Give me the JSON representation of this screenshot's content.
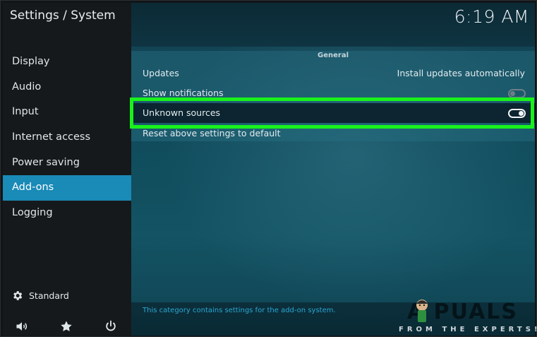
{
  "window": {
    "title": "Settings / System",
    "clock": "6:19 AM"
  },
  "sidebar": {
    "items": [
      {
        "label": "Display",
        "active": false
      },
      {
        "label": "Audio",
        "active": false
      },
      {
        "label": "Input",
        "active": false
      },
      {
        "label": "Internet access",
        "active": false
      },
      {
        "label": "Power saving",
        "active": false
      },
      {
        "label": "Add-ons",
        "active": true
      },
      {
        "label": "Logging",
        "active": false
      }
    ],
    "settings_level": {
      "icon": "gear-icon",
      "label": "Standard"
    },
    "bottom_icons": [
      "volume-icon",
      "star-icon",
      "power-icon"
    ]
  },
  "main": {
    "section_header": "General",
    "rows": [
      {
        "label": "Updates",
        "value": "Install updates automatically"
      },
      {
        "label": "Show notifications",
        "toggle": "off"
      },
      {
        "label": "Unknown sources",
        "toggle": "on"
      },
      {
        "label": "Reset above settings to default"
      }
    ],
    "footer_text": "This category contains settings for the add-on system."
  },
  "watermark": {
    "letters": "A  PUALS",
    "tagline": "FROM THE EXPERTS!"
  },
  "colors": {
    "accent": "#1a8ab7",
    "highlight": "#19f21b",
    "footer_text": "#2aa7d2"
  }
}
